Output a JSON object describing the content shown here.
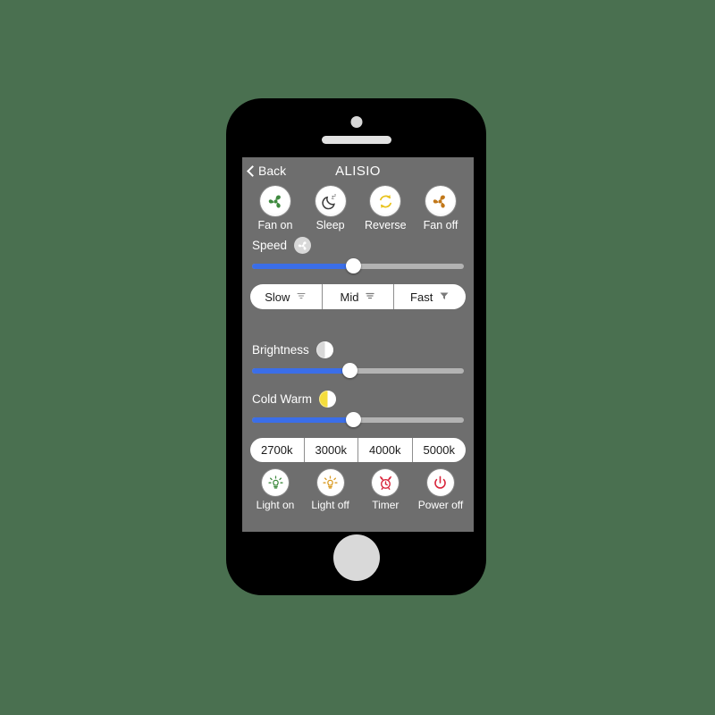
{
  "background_color": "#4a7050",
  "device": {
    "name": "smartphone-mockup",
    "body_color": "#000000",
    "screen_bg": "#6e6e6e",
    "home_button_color": "#d9d9d9"
  },
  "nav": {
    "back_label": "Back",
    "back_icon": "chevron-left-icon",
    "title": "ALISIO"
  },
  "fan_modes": [
    {
      "label": "Fan on",
      "icon": "fan-icon",
      "color": "#3f8a3f"
    },
    {
      "label": "Sleep",
      "icon": "moon-sleep-icon",
      "color": "#3c3c3c"
    },
    {
      "label": "Reverse",
      "icon": "reverse-arrows-icon",
      "color": "#e8c21a"
    },
    {
      "label": "Fan off",
      "icon": "fan-icon",
      "color": "#c2781a"
    }
  ],
  "speed": {
    "label": "Speed",
    "badge_icon": "fan-icon",
    "slider_value": 48,
    "fill_color": "#3b6ee8",
    "track_color": "#b3b3b3"
  },
  "speed_presets": [
    {
      "label": "Slow",
      "icon": "tornado-light-icon"
    },
    {
      "label": "Mid",
      "icon": "tornado-medium-icon"
    },
    {
      "label": "Fast",
      "icon": "tornado-solid-icon"
    }
  ],
  "brightness": {
    "label": "Brightness",
    "badge_icon": "half-circle-contrast-icon",
    "slider_value": 46
  },
  "cold_warm": {
    "label": "Cold Warm",
    "badge_icon": "half-circle-warm-icon",
    "badge_color": "#f5dd3c",
    "slider_value": 48
  },
  "color_temperatures": [
    {
      "label": "2700k"
    },
    {
      "label": "3000k"
    },
    {
      "label": "4000k"
    },
    {
      "label": "5000k"
    }
  ],
  "light_actions": [
    {
      "label": "Light on",
      "icon": "bulb-on-icon",
      "color": "#3f8a3f"
    },
    {
      "label": "Light off",
      "icon": "bulb-off-icon",
      "color": "#d99a20"
    },
    {
      "label": "Timer",
      "icon": "alarm-clock-icon",
      "color": "#d9263c"
    },
    {
      "label": "Power off",
      "icon": "power-icon",
      "color": "#d9263c"
    }
  ]
}
